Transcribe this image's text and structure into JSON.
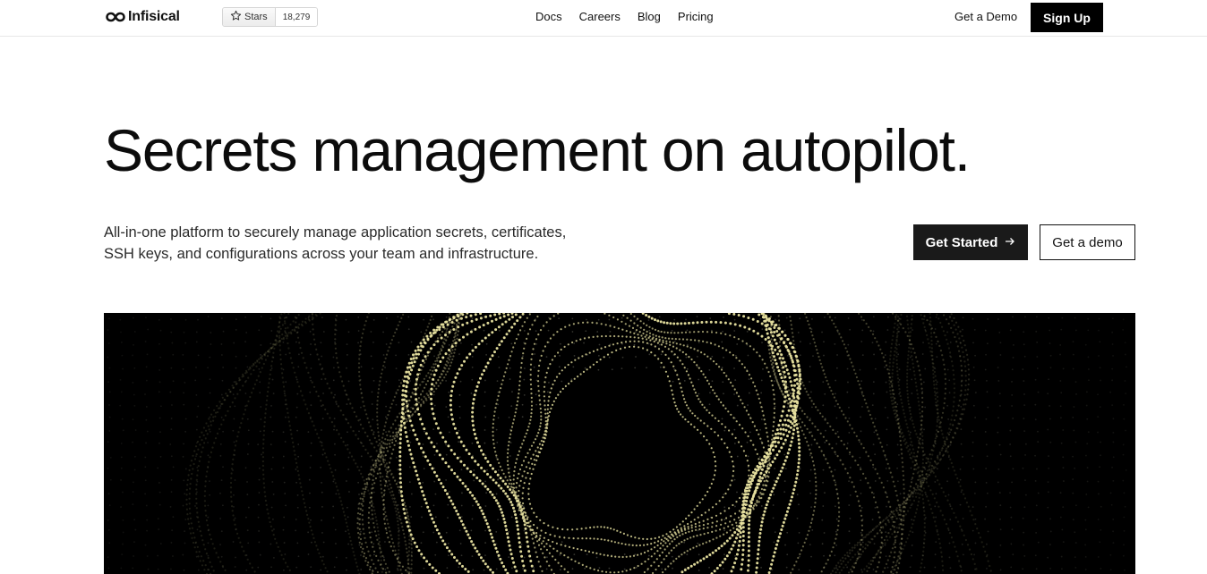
{
  "brand": {
    "name": "Infisical",
    "logo_icon": "infinity-icon"
  },
  "github": {
    "stars_label": "Stars",
    "stars_count": "18,279",
    "icon": "star-icon"
  },
  "nav": {
    "links": [
      {
        "label": "Docs"
      },
      {
        "label": "Careers"
      },
      {
        "label": "Blog"
      },
      {
        "label": "Pricing"
      }
    ],
    "get_demo": "Get a Demo",
    "sign_up": "Sign Up"
  },
  "hero": {
    "title": "Secrets management on autopilot.",
    "subtitle_line1": "All-in-one platform to securely manage application secrets, certificates,",
    "subtitle_line2": "SSH keys, and configurations across your team and infrastructure.",
    "primary_cta": "Get Started",
    "primary_cta_icon": "arrow-right-icon",
    "secondary_cta": "Get a demo"
  },
  "colors": {
    "background": "#ffffff",
    "text": "#111111",
    "button_dark": "#1a1a1a",
    "visual_bg": "#000000",
    "particle": "#e9e3a0"
  }
}
